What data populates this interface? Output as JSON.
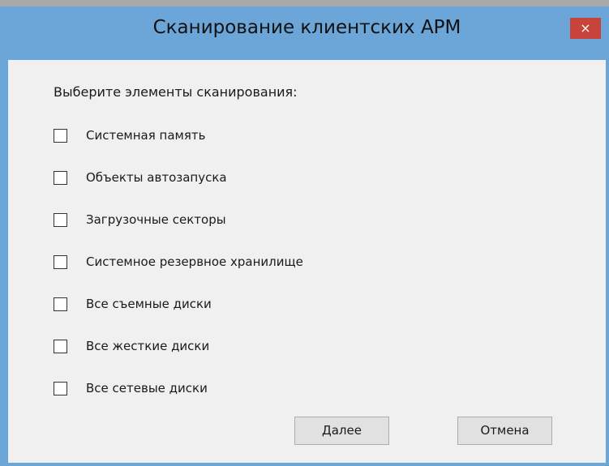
{
  "window": {
    "title": "Сканирование клиентских АРМ",
    "close_label": "×"
  },
  "content": {
    "prompt": "Выберите элементы сканирования:",
    "options": [
      {
        "label": "Системная память",
        "checked": false
      },
      {
        "label": "Объекты автозапуска",
        "checked": false
      },
      {
        "label": "Загрузочные секторы",
        "checked": false
      },
      {
        "label": "Системное резервное хранилище",
        "checked": false
      },
      {
        "label": "Все съемные диски",
        "checked": false
      },
      {
        "label": "Все жесткие диски",
        "checked": false
      },
      {
        "label": "Все сетевые диски",
        "checked": false
      }
    ]
  },
  "buttons": {
    "next_label": "Далее",
    "cancel_label": "Отмена"
  },
  "colors": {
    "titlebar": "#6ca6d8",
    "close": "#c7433b",
    "background": "#f0f0f0"
  }
}
